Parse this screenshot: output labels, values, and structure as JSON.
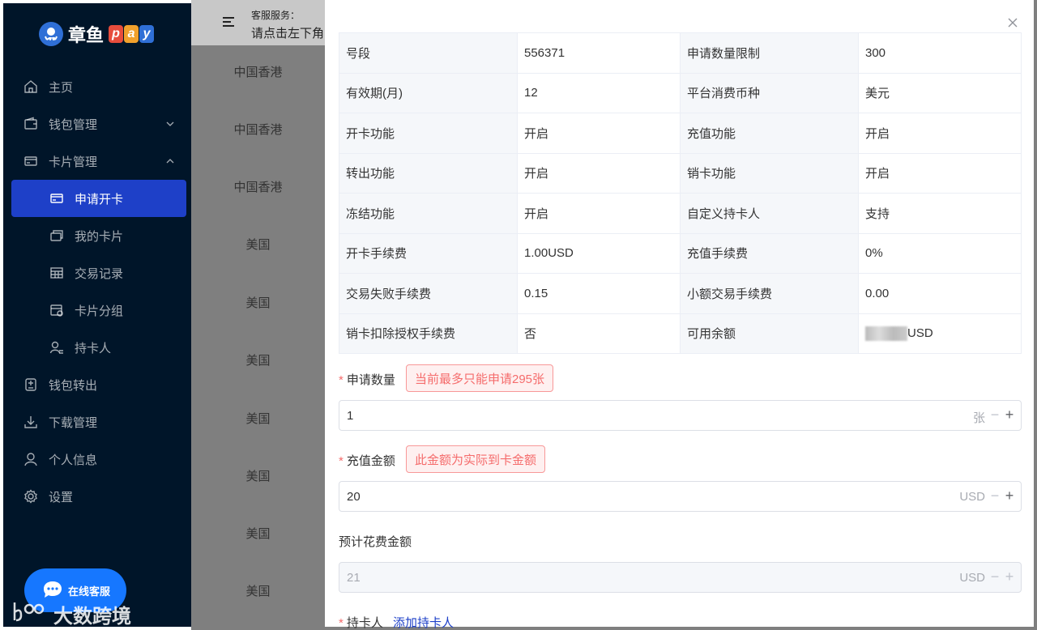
{
  "app": {
    "logo_text": "章鱼",
    "logo_pay": [
      "p",
      "a",
      "y"
    ],
    "logo_pay_colors": [
      "#e74c3c",
      "#f1a12c",
      "#2f6fd6"
    ]
  },
  "sidebar": {
    "items": [
      {
        "label": "主页",
        "icon": "home-icon"
      },
      {
        "label": "钱包管理",
        "icon": "wallet-icon",
        "arrow": "chevron-down"
      },
      {
        "label": "卡片管理",
        "icon": "card-icon",
        "arrow": "chevron-up"
      },
      {
        "label": "申请开卡",
        "icon": "card-apply-icon",
        "sub": true,
        "active": true
      },
      {
        "label": "我的卡片",
        "icon": "cards-icon",
        "sub": true
      },
      {
        "label": "交易记录",
        "icon": "table-icon",
        "sub": true
      },
      {
        "label": "卡片分组",
        "icon": "group-icon",
        "sub": true
      },
      {
        "label": "持卡人",
        "icon": "user-card-icon",
        "sub": true
      },
      {
        "label": "钱包转出",
        "icon": "transfer-icon"
      },
      {
        "label": "下载管理",
        "icon": "download-icon"
      },
      {
        "label": "个人信息",
        "icon": "user-icon"
      },
      {
        "label": "设置",
        "icon": "gear-icon"
      }
    ],
    "chat_label": "在线客服",
    "watermark": "大数跨境"
  },
  "header": {
    "service_label": "客服服务：",
    "service_text": "请点击左下角"
  },
  "regions": [
    "中国香港",
    "中国香港",
    "中国香港",
    "美国",
    "美国",
    "美国",
    "美国",
    "美国",
    "美国",
    "美国"
  ],
  "drawer": {
    "info": [
      [
        "号段",
        "556371",
        "申请数量限制",
        "300"
      ],
      [
        "有效期(月)",
        "12",
        "平台消费币种",
        "美元"
      ],
      [
        "开卡功能",
        "开启",
        "充值功能",
        "开启"
      ],
      [
        "转出功能",
        "开启",
        "销卡功能",
        "开启"
      ],
      [
        "冻结功能",
        "开启",
        "自定义持卡人",
        "支持"
      ],
      [
        "开卡手续费",
        "1.00USD",
        "充值手续费",
        "0%"
      ],
      [
        "交易失败手续费",
        "0.15",
        "小额交易手续费",
        "0.00"
      ],
      [
        "销卡扣除授权手续费",
        "否",
        "可用余额",
        "USD"
      ]
    ],
    "quantity": {
      "label": "申请数量",
      "tip": "当前最多只能申请295张",
      "value": "1",
      "suffix": "张"
    },
    "amount": {
      "label": "充值金额",
      "tip": "此金额为实际到卡金额",
      "value": "20",
      "suffix": "USD"
    },
    "estimate": {
      "label": "预计花费金额",
      "value": "21",
      "suffix": "USD"
    },
    "cardholder": {
      "label": "持卡人",
      "link": "添加持卡人"
    },
    "stepper": {
      "minus": "−",
      "plus": "+"
    }
  }
}
